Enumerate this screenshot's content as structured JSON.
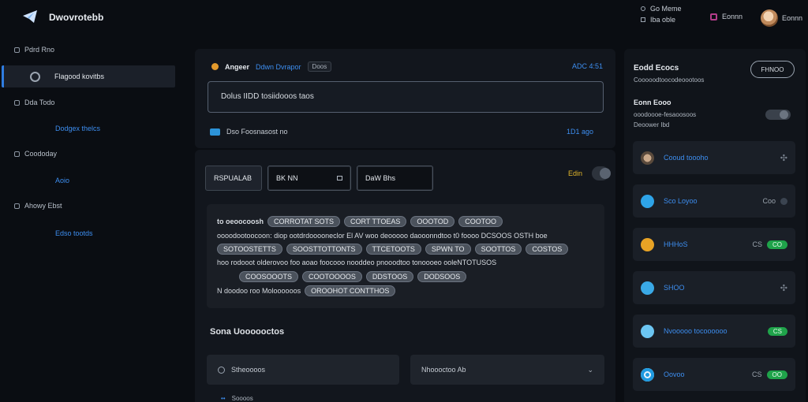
{
  "app": {
    "name": "Dwovrotebb"
  },
  "topbar": {
    "left_line1": "Go Meme",
    "left_line2": "Iba oble",
    "right_label": "Eonnn"
  },
  "sidebar": {
    "groups": [
      {
        "label": "Pdrd Rno"
      },
      {
        "label": "Dda Todo"
      },
      {
        "label": "Coododay"
      },
      {
        "label": "Ahowy Ebst"
      }
    ],
    "active_item": "Flagood kovitbs",
    "subs": [
      "Dodgex thelcs",
      "Aoio",
      "Edso tootds"
    ]
  },
  "top_panel": {
    "title": "Angeer",
    "title_link": "Ddwn Dvrapor",
    "badge": "Doos",
    "corner_value": "ADC 4:51",
    "search_value": "Dolus IIDD tosiidooos taos",
    "row_label": "Dso Foosnasost no",
    "row_value": "1D1 ago"
  },
  "main": {
    "tabs": [
      "RSPUALAB",
      "BK NN",
      "DaW Bhs"
    ],
    "toggle_label": "Edin",
    "lines": {
      "l1_label": "to oeoocoosh",
      "l1_chips": [
        "CORROTAT SOTS",
        "CORT TTOEAS",
        "OOOTOD",
        "COOTOO"
      ],
      "l2_text": "oooodootoocoon: diop ootdrdooooneclor El AV woo deooooo daooonndtoo t0 foooo DCSOOS OSTH boe",
      "l3_chips": [
        "SOTOOSTETTS",
        "SOOSTTOTTONTS",
        "TTCETOOTS",
        "SPWN TO",
        "SOOTTOS",
        "COSTOS"
      ],
      "l4_text": "hoo rodooot olderovoo foo aoao  foocooo nooddeo pnooodtoo tonoooeo ooleNTOTUSOS",
      "l5_chips": [
        "COOSOOOTS",
        "COOTOOOOS",
        "DDSTOOS",
        "DODSOOS"
      ],
      "l6_label": "N doodoo roo Moloooooos",
      "l6_chip": "OROOHOT CONTTHOS"
    },
    "section_title": "Sona Uoooooctos",
    "select_left": "Stheoooos",
    "select_right": "Nhoooctoo Ab",
    "list_first": "Soooos"
  },
  "right_panel": {
    "title": "Eodd Ecocs",
    "subtitle": "Cooooodtoocodeoootoos",
    "button": "FHNOO",
    "sec_title": "Eonn Eooo",
    "sec_line1": "ooodoooe-fesaoosoos",
    "sec_line2": "Deoower Ibd",
    "items": [
      {
        "label": "Cooud toooho",
        "status": "",
        "pill": ""
      },
      {
        "label": "Sco Loyoo",
        "status": "Coo",
        "pill": ""
      },
      {
        "label": "HHHoS",
        "status": "CS",
        "pill": "CO"
      },
      {
        "label": "SHOO",
        "status": "",
        "pill": ""
      },
      {
        "label": "Nvooooo tocoooooo",
        "status": "",
        "pill": "CS"
      },
      {
        "label": "Oovoo",
        "status": "CS",
        "pill": "OO"
      }
    ]
  },
  "colors": {
    "accent": "#3d8ef0",
    "success": "#1fa34a",
    "panel": "#12161d",
    "background": "#0a0d12"
  }
}
